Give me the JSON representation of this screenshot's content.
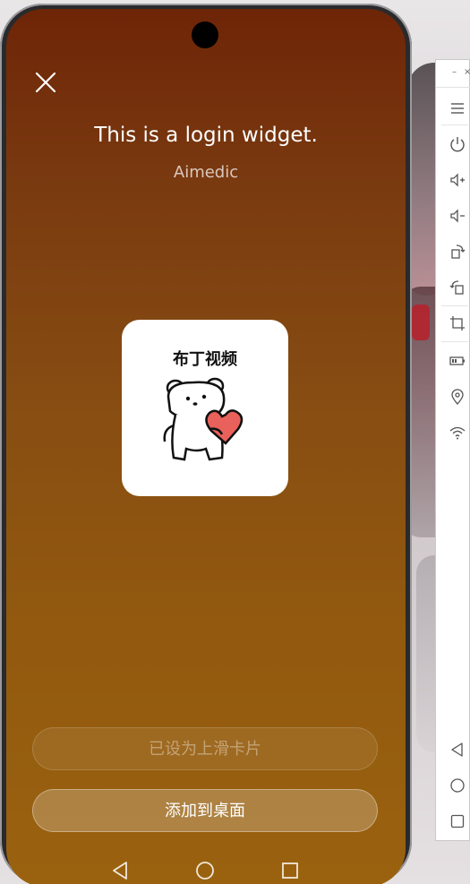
{
  "widget_dialog": {
    "title": "This is a login widget.",
    "subtitle": "Aimedic",
    "app_name": "布丁视频",
    "app_icon": "bear-holding-heart-icon",
    "upslide_button_label": "已设为上滑卡片",
    "add_to_desktop_label": "添加到桌面",
    "close_icon": "close-icon"
  },
  "nav_bar": {
    "back_icon": "back-triangle-icon",
    "home_icon": "home-circle-icon",
    "recents_icon": "recents-square-icon"
  },
  "emulator_toolbar": {
    "minimize_glyph": "–",
    "close_glyph": "×",
    "items": [
      {
        "name": "menu-icon"
      },
      {
        "name": "power-icon"
      },
      {
        "name": "volume-up-icon"
      },
      {
        "name": "volume-down-icon"
      },
      {
        "name": "rotate-icon"
      },
      {
        "name": "rotate-screen-icon"
      },
      {
        "name": "crop-icon"
      },
      {
        "name": "battery-icon"
      },
      {
        "name": "location-icon"
      },
      {
        "name": "wifi-icon"
      },
      {
        "name": "back-icon"
      },
      {
        "name": "home-icon"
      },
      {
        "name": "overview-icon"
      }
    ]
  },
  "colors": {
    "dialog_gradient_top": "#6e2507",
    "dialog_gradient_bottom": "#9a620f",
    "heart": "#e8615a"
  }
}
